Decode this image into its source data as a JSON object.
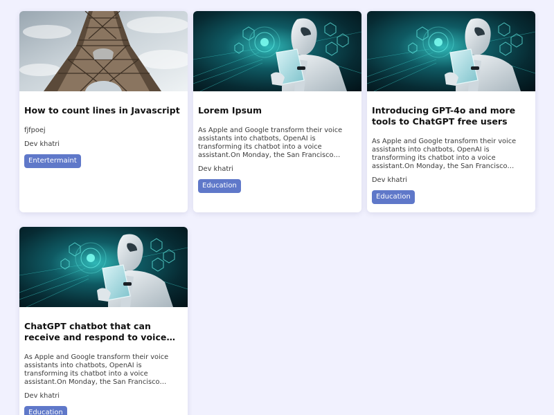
{
  "cards": [
    {
      "image": "eiffel-tower-photo",
      "title": "How to count lines in Javascript",
      "description": "fjfpoej",
      "author": "Dev khatri",
      "tag": "Entertermaint"
    },
    {
      "image": "ai-robot-tablet-illustration",
      "title": "Lorem Ipsum",
      "description": "As Apple and Google transform their voice assistants into chatbots, OpenAI is transforming its chatbot into a voice assistant.On Monday, the San Francisco artificial intelligence start-up unveiled a new version",
      "author": "Dev khatri",
      "tag": "Education"
    },
    {
      "image": "ai-robot-tablet-illustration",
      "title": "Introducing GPT-4o and more tools to ChatGPT free users",
      "description": "As Apple and Google transform their voice assistants into chatbots, OpenAI is transforming its chatbot into a voice assistant.On Monday, the San Francisco artificial intelligence start-up unveiled a new version",
      "author": "Dev khatri",
      "tag": "Education"
    },
    {
      "image": "ai-robot-tablet-illustration",
      "title": "ChatGPT chatbot that can receive and respond to voice commands, images and videos",
      "description": "As Apple and Google transform their voice assistants into chatbots, OpenAI is transforming its chatbot into a voice assistant.On Monday, the San Francisco artificial intelligence start-up unveiled a new version",
      "author": "Dev khatri",
      "tag": "Education"
    }
  ],
  "colors": {
    "page_background": "#f1f1fe",
    "card_background": "#ffffff",
    "tag_background": "#5f78c9",
    "tag_text": "#ffffff",
    "title_text": "#111111",
    "body_text": "#3a3a3a"
  }
}
